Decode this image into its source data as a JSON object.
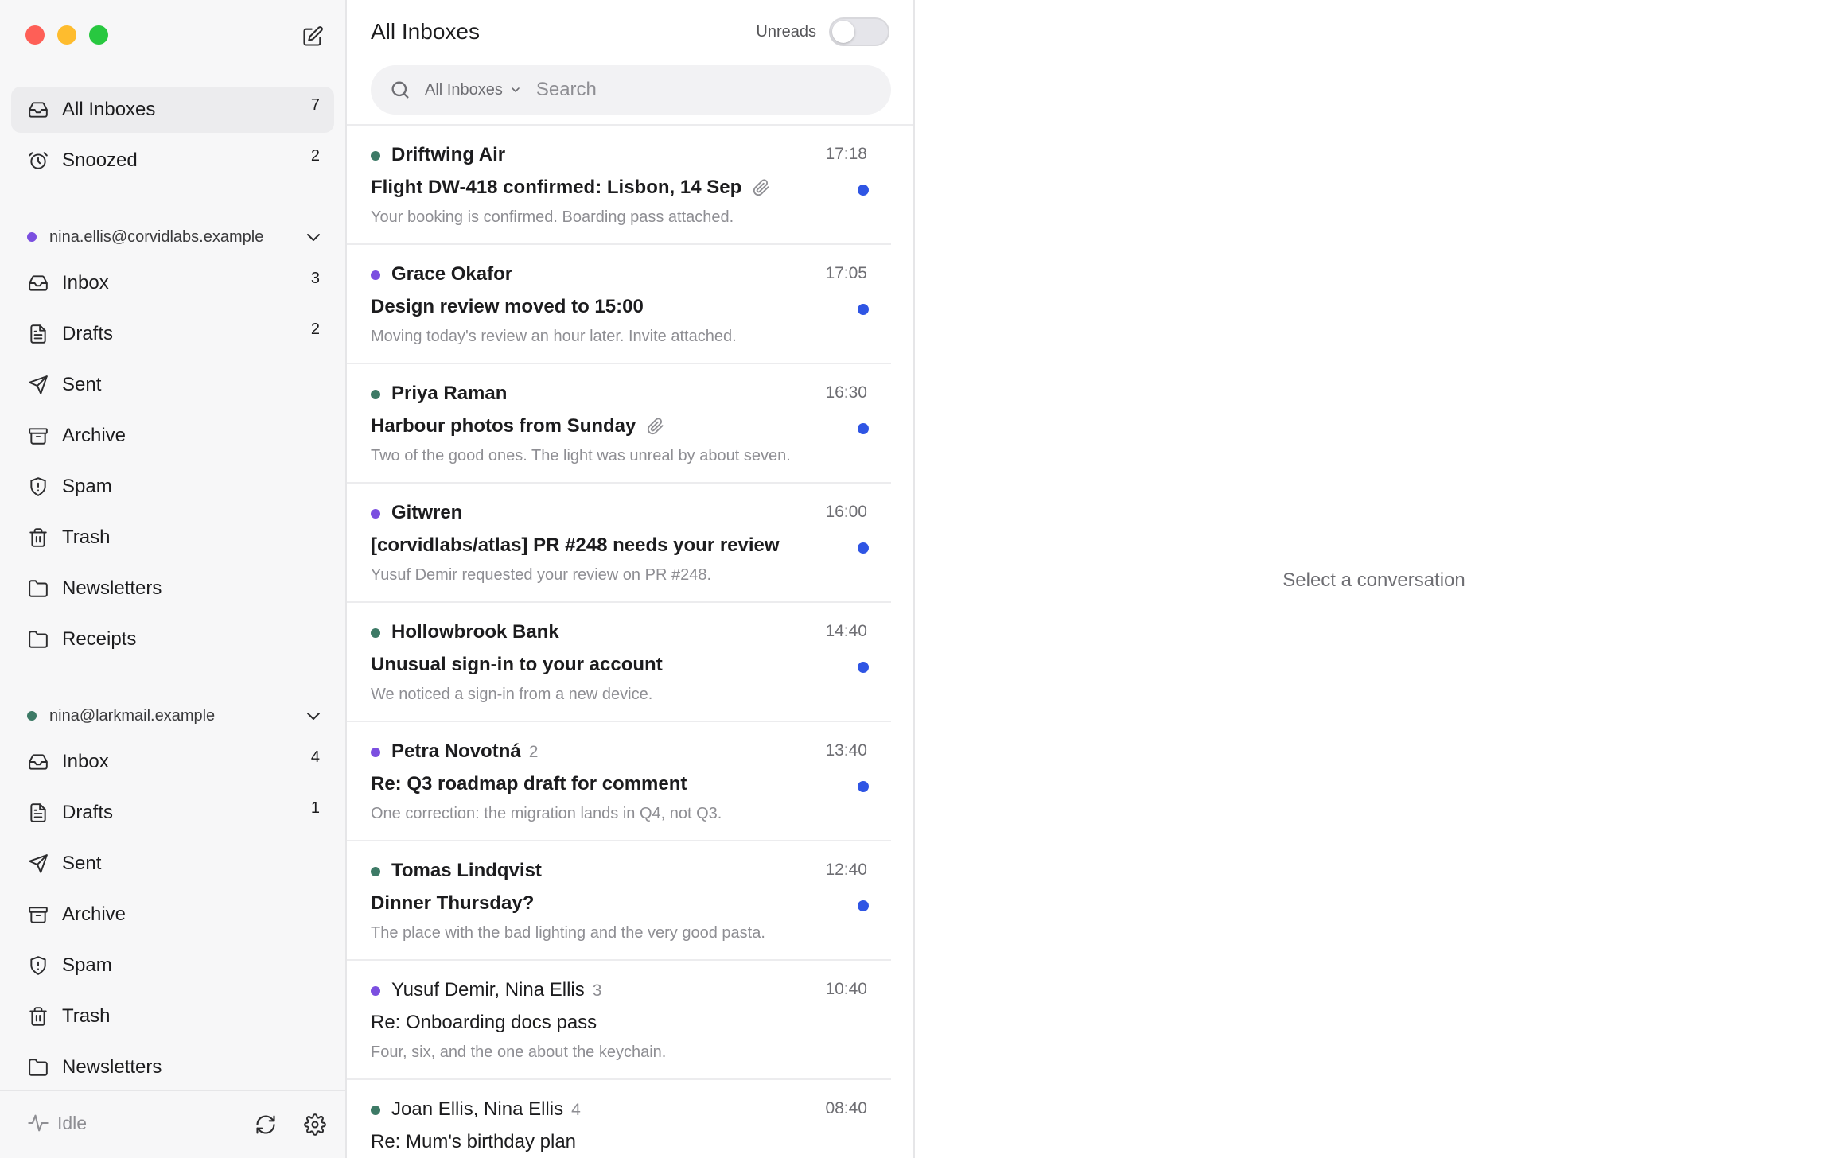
{
  "sidebar": {
    "top_items": [
      {
        "label": "All Inboxes",
        "count": "7",
        "icon": "inbox-icon"
      },
      {
        "label": "Snoozed",
        "count": "2",
        "icon": "alarm-clock-icon"
      }
    ],
    "accounts": [
      {
        "email": "nina.ellis@corvidlabs.example",
        "dot_color": "#7b4fe0",
        "folders": [
          {
            "label": "Inbox",
            "count": "3",
            "icon": "inbox-icon"
          },
          {
            "label": "Drafts",
            "count": "2",
            "icon": "document-icon"
          },
          {
            "label": "Sent",
            "count": "",
            "icon": "send-icon"
          },
          {
            "label": "Archive",
            "count": "",
            "icon": "archive-icon"
          },
          {
            "label": "Spam",
            "count": "",
            "icon": "shield-icon"
          },
          {
            "label": "Trash",
            "count": "",
            "icon": "trash-icon"
          },
          {
            "label": "Newsletters",
            "count": "",
            "icon": "folder-icon"
          },
          {
            "label": "Receipts",
            "count": "",
            "icon": "folder-icon"
          }
        ]
      },
      {
        "email": "nina@larkmail.example",
        "dot_color": "#3d7a66",
        "folders": [
          {
            "label": "Inbox",
            "count": "4",
            "icon": "inbox-icon"
          },
          {
            "label": "Drafts",
            "count": "1",
            "icon": "document-icon"
          },
          {
            "label": "Sent",
            "count": "",
            "icon": "send-icon"
          },
          {
            "label": "Archive",
            "count": "",
            "icon": "archive-icon"
          },
          {
            "label": "Spam",
            "count": "",
            "icon": "shield-icon"
          },
          {
            "label": "Trash",
            "count": "",
            "icon": "trash-icon"
          },
          {
            "label": "Newsletters",
            "count": "",
            "icon": "folder-icon"
          }
        ]
      }
    ],
    "footer": {
      "status_label": "Idle"
    }
  },
  "list": {
    "title": "All Inboxes",
    "unreads_label": "Unreads",
    "unreads_on": false,
    "search": {
      "scope": "All Inboxes",
      "placeholder": "Search",
      "value": ""
    },
    "scroll_fraction_visible": 0.44,
    "messages": [
      {
        "sender": "Driftwing Air",
        "thread_count": "",
        "time": "17:18",
        "subject": "Flight DW-418 confirmed: Lisbon, 14 Sep",
        "attachment": true,
        "unread": true,
        "preview": "Your booking is confirmed. Boarding pass attached.",
        "dot_color": "#3d7a66"
      },
      {
        "sender": "Grace Okafor",
        "thread_count": "",
        "time": "17:05",
        "subject": "Design review moved to 15:00",
        "attachment": false,
        "unread": true,
        "preview": "Moving today's review an hour later. Invite attached.",
        "dot_color": "#7b4fe0"
      },
      {
        "sender": "Priya Raman",
        "thread_count": "",
        "time": "16:30",
        "subject": "Harbour photos from Sunday",
        "attachment": true,
        "unread": true,
        "preview": "Two of the good ones. The light was unreal by about seven.",
        "dot_color": "#3d7a66"
      },
      {
        "sender": "Gitwren",
        "thread_count": "",
        "time": "16:00",
        "subject": "[corvidlabs/atlas] PR #248 needs your review",
        "attachment": false,
        "unread": true,
        "preview": "Yusuf Demir requested your review on PR #248.",
        "dot_color": "#7b4fe0"
      },
      {
        "sender": "Hollowbrook Bank",
        "thread_count": "",
        "time": "14:40",
        "subject": "Unusual sign-in to your account",
        "attachment": false,
        "unread": true,
        "preview": "We noticed a sign-in from a new device.",
        "dot_color": "#3d7a66"
      },
      {
        "sender": "Petra Novotná",
        "thread_count": "2",
        "time": "13:40",
        "subject": "Re: Q3 roadmap draft for comment",
        "attachment": false,
        "unread": true,
        "preview": "One correction: the migration lands in Q4, not Q3.",
        "dot_color": "#7b4fe0"
      },
      {
        "sender": "Tomas Lindqvist",
        "thread_count": "",
        "time": "12:40",
        "subject": "Dinner Thursday?",
        "attachment": false,
        "unread": true,
        "preview": "The place with the bad lighting and the very good pasta.",
        "dot_color": "#3d7a66"
      },
      {
        "sender": "Yusuf Demir, Nina Ellis",
        "thread_count": "3",
        "time": "10:40",
        "subject": "Re: Onboarding docs pass",
        "attachment": false,
        "unread": false,
        "preview": "Four, six, and the one about the keychain.",
        "dot_color": "#7b4fe0"
      },
      {
        "sender": "Joan Ellis, Nina Ellis",
        "thread_count": "4",
        "time": "08:40",
        "subject": "Re: Mum's birthday plan",
        "attachment": false,
        "unread": false,
        "preview": "",
        "dot_color": "#3d7a66"
      }
    ]
  },
  "detail": {
    "empty_text": "Select a conversation"
  }
}
